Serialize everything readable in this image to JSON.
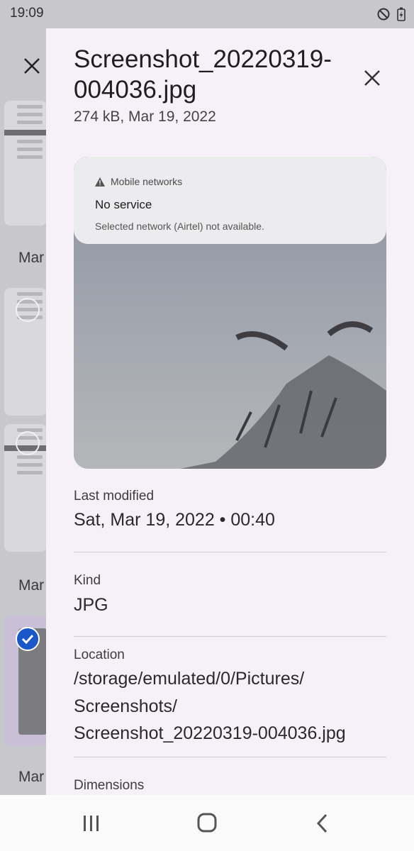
{
  "status_bar": {
    "time": "19:09"
  },
  "background": {
    "date_labels": [
      "Mar",
      "Mar",
      "Mar"
    ]
  },
  "sheet": {
    "title": "Screenshot_20220319-004036.jpg",
    "subtitle": "274 kB, Mar 19, 2022",
    "preview": {
      "notification_app": "Mobile networks",
      "notification_title": "No service",
      "notification_body": "Selected network (Airtel) not available."
    },
    "fields": [
      {
        "label": "Last modified",
        "value": "Sat, Mar 19, 2022 • 00:40"
      },
      {
        "label": "Kind",
        "value": "JPG"
      },
      {
        "label": "Location",
        "value_lines": [
          "/storage/emulated/0/Pictures/",
          "Screenshots/",
          "Screenshot_20220319-004036.jpg"
        ]
      },
      {
        "label": "Dimensions"
      }
    ]
  },
  "colors": {
    "sheet_background": "#f6f1f8",
    "selection_accent": "#1a57c9"
  },
  "icons": {
    "close": "close-icon",
    "dnd": "do-not-disturb-icon",
    "battery": "battery-charging-icon",
    "nav_recents": "recents-icon",
    "nav_home": "home-icon",
    "nav_back": "back-icon"
  }
}
